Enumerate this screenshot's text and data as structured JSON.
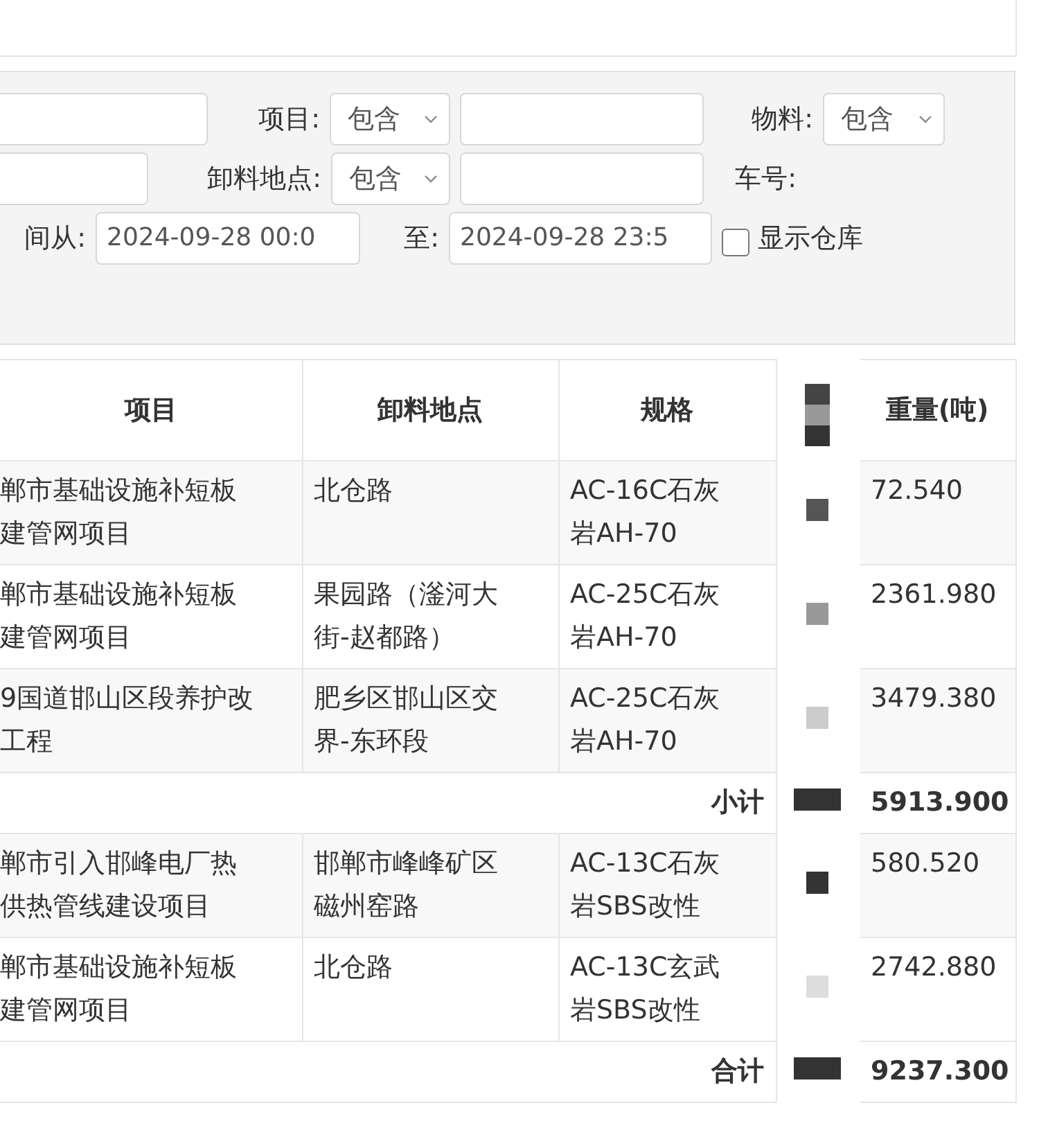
{
  "filters": {
    "rows": [
      [
        {
          "kind": "input"
        },
        {
          "kind": "label",
          "text": "项目:"
        },
        {
          "kind": "select",
          "value": "包含"
        },
        {
          "kind": "input"
        },
        {
          "kind": "label",
          "text": "物料:"
        },
        {
          "kind": "select",
          "value": "包含"
        }
      ],
      [
        {
          "kind": "input"
        },
        {
          "kind": "label",
          "text": "卸料地点:"
        },
        {
          "kind": "select",
          "value": "包含"
        },
        {
          "kind": "input"
        },
        {
          "kind": "label",
          "text": "车号:"
        }
      ],
      [
        {
          "kind": "label",
          "text": "间从:"
        },
        {
          "kind": "date",
          "value": "2024-09-28 00:0"
        },
        {
          "kind": "label",
          "text": "至:"
        },
        {
          "kind": "date",
          "value": "2024-09-28 23:5"
        },
        {
          "kind": "checkbox",
          "label": "显示仓库",
          "checked": false
        }
      ]
    ]
  },
  "table": {
    "columns": [
      {
        "label": "项目"
      },
      {
        "label": "卸料地点"
      },
      {
        "label": "规格"
      },
      {
        "label": "重量(吨)"
      }
    ],
    "rows": [
      {
        "kind": "item",
        "project": [
          "郸市基础设施补短板",
          "建管网项目"
        ],
        "location": [
          "北仓路"
        ],
        "spec": [
          "AC-16C石灰",
          "岩AH-70"
        ],
        "weight": "72.540"
      },
      {
        "kind": "item",
        "project": [
          "郸市基础设施补短板",
          "建管网项目"
        ],
        "location": [
          "果园路（滏河大",
          "街-赵都路）"
        ],
        "spec": [
          "AC-25C石灰",
          "岩AH-70"
        ],
        "weight": "2361.980"
      },
      {
        "kind": "item",
        "project": [
          "9国道邯山区段养护改",
          "工程"
        ],
        "location": [
          "肥乡区邯山区交",
          "界-东环段"
        ],
        "spec": [
          "AC-25C石灰",
          "岩AH-70"
        ],
        "weight": "3479.380"
      },
      {
        "kind": "summary",
        "label": "小计",
        "weight": "5913.900"
      },
      {
        "kind": "item",
        "project": [
          "郸市引入邯峰电厂热",
          "供热管线建设项目"
        ],
        "location": [
          "邯郸市峰峰矿区",
          "磁州窑路"
        ],
        "spec": [
          "AC-13C石灰",
          "岩SBS改性"
        ],
        "weight": "580.520"
      },
      {
        "kind": "item",
        "project": [
          "郸市基础设施补短板",
          "建管网项目"
        ],
        "location": [
          "北仓路"
        ],
        "spec": [
          "AC-13C玄武",
          "岩SBS改性"
        ],
        "weight": "2742.880"
      },
      {
        "kind": "summary",
        "label": "合计",
        "weight": "9237.300"
      }
    ]
  }
}
